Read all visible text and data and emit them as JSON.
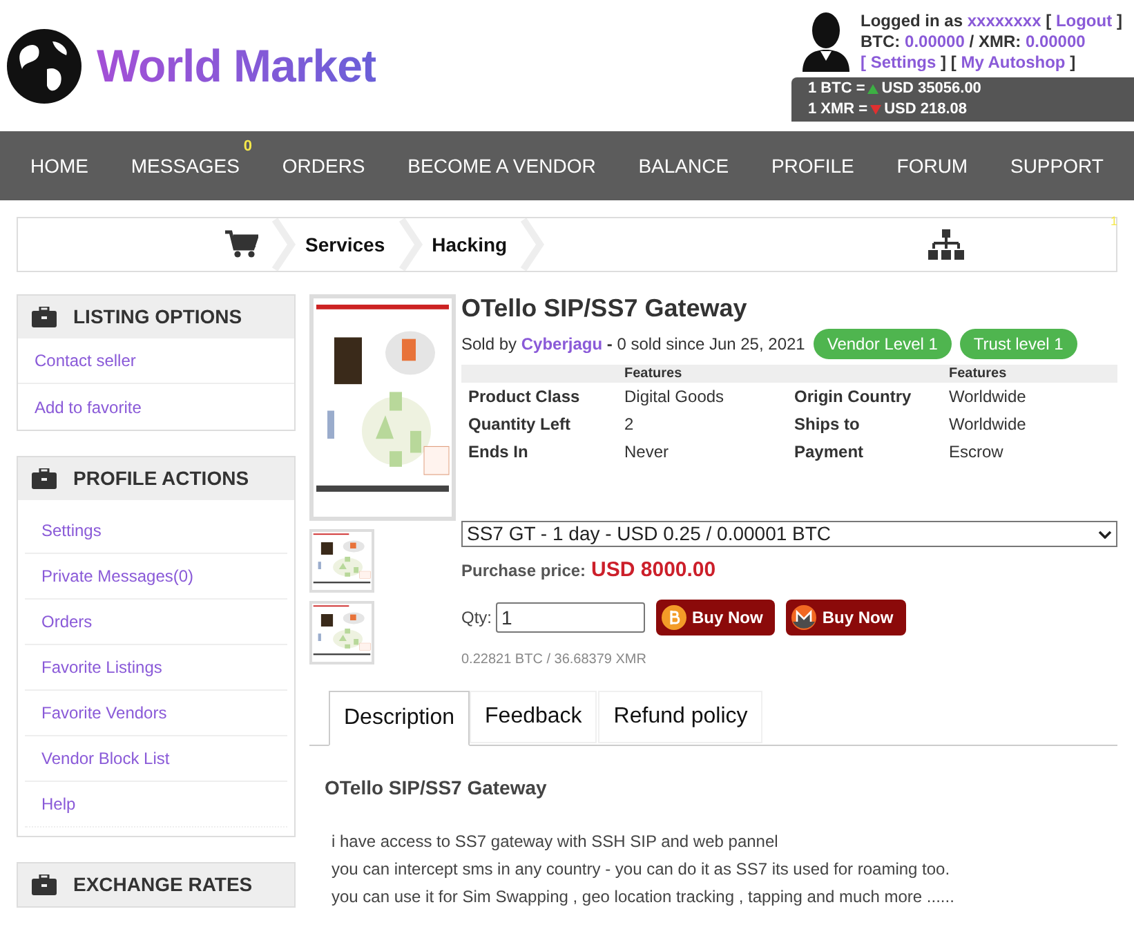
{
  "logo": {
    "text": "World Market"
  },
  "user": {
    "logged_in_label": "Logged in as",
    "username": "xxxxxxxx",
    "logout_open": "[",
    "logout": "Logout",
    "logout_close": "]",
    "btc_label": "BTC:",
    "btc_balance": "0.00000",
    "separator": "/",
    "xmr_label": "XMR:",
    "xmr_balance": "0.00000",
    "links_open": "[",
    "links": [
      "Settings",
      "My Autoshop"
    ],
    "links_between": "] [",
    "links_close": "]"
  },
  "rates": [
    {
      "label": "1 BTC =",
      "value": "USD 35056.00",
      "kind": "up",
      "color": "#3cb043"
    },
    {
      "label": "1 XMR =",
      "value": "USD 218.08",
      "kind": "down",
      "color": "#e03030"
    }
  ],
  "nav": [
    {
      "label": "HOME"
    },
    {
      "label": "MESSAGES",
      "badge": "0"
    },
    {
      "label": "ORDERS"
    },
    {
      "label": "BECOME A VENDOR"
    },
    {
      "label": "BALANCE"
    },
    {
      "label": "PROFILE"
    },
    {
      "label": "FORUM"
    },
    {
      "label": "SUPPORT"
    }
  ],
  "breadcrumb": [
    "Services",
    "Hacking"
  ],
  "breadcrumb_marker": "1",
  "sidebar": [
    {
      "title": "LISTING OPTIONS",
      "items": [
        "Contact seller",
        "Add to favorite"
      ]
    },
    {
      "title": "PROFILE ACTIONS",
      "items": [
        "Settings",
        "Private Messages(0)",
        "Orders",
        "Favorite Listings",
        "Favorite Vendors",
        "Vendor Block List",
        "Help"
      ]
    },
    {
      "title": "EXCHANGE RATES"
    }
  ],
  "product": {
    "title": "OTello SIP/SS7 Gateway",
    "sold_by_label": "Sold by",
    "vendor": "Cyberjagu",
    "dash": "-",
    "sold_info": "0 sold since Jun 25, 2021",
    "badges": [
      "Vendor Level 1",
      "Trust level 1"
    ],
    "feature_headers": [
      "Features",
      "Features"
    ],
    "features": [
      [
        "Product Class",
        "Digital Goods",
        "Origin Country",
        "Worldwide"
      ],
      [
        "Quantity Left",
        "2",
        "Ships to",
        "Worldwide"
      ],
      [
        "Ends In",
        "Never",
        "Payment",
        "Escrow"
      ]
    ],
    "option": "SS7 GT - 1 day - USD 0.25 / 0.00001 BTC",
    "price_label": "Purchase price:",
    "price": "USD 8000.00",
    "qty_label": "Qty:",
    "qty": "1",
    "buy_buttons": [
      {
        "kind": "btc",
        "label": "Buy Now"
      },
      {
        "kind": "xmr",
        "label": "Buy Now"
      }
    ],
    "crypto_price": "0.22821 BTC / 36.68379 XMR"
  },
  "tabs": [
    {
      "label": "Description",
      "selected": true
    },
    {
      "label": "Feedback",
      "selected": false
    },
    {
      "label": "Refund policy",
      "selected": false
    }
  ],
  "description": {
    "title": "OTello SIP/SS7 Gateway",
    "lines": [
      "i have access to SS7 gateway with SSH SIP and web pannel",
      "you can intercept sms in any country - you can do it as SS7 its used for roaming too.",
      "you can use it for Sim Swapping , geo location tracking , tapping and much more ......"
    ]
  }
}
